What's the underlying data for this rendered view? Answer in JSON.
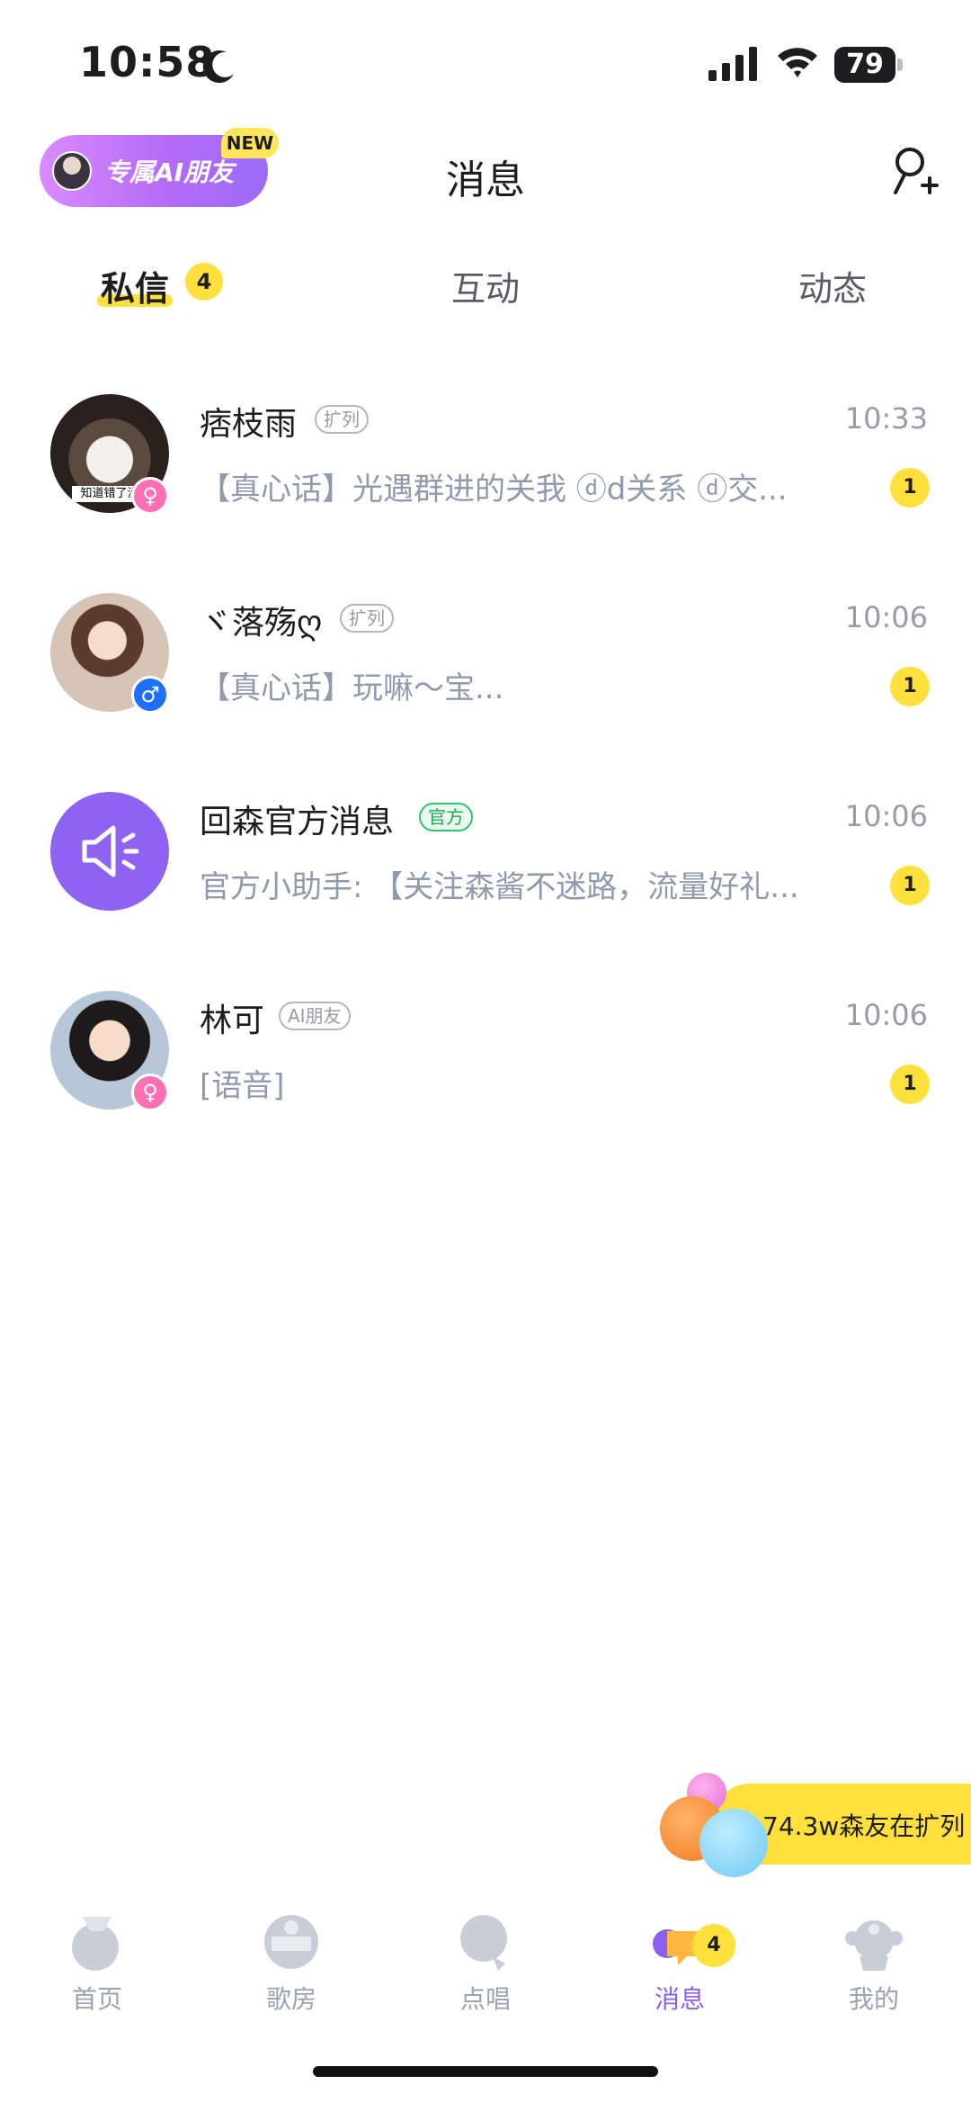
{
  "status_bar": {
    "time": "10:58",
    "battery": "79"
  },
  "header": {
    "ai_button_label": "专属AI朋友",
    "new_badge": "NEW",
    "title": "消息"
  },
  "tabs": [
    {
      "label": "私信",
      "count": "4",
      "active": true
    },
    {
      "label": "互动"
    },
    {
      "label": "动态"
    }
  ],
  "messages": [
    {
      "name": "痞枝雨",
      "tag": "扩列",
      "time": "10:33",
      "preview": "【真心话】光遇群进的关我 ⓓd关系 ⓓ交...",
      "unread": "1",
      "gender": "♀",
      "avatar_caption": "知道错了没"
    },
    {
      "name": "ヾ落殇ღ",
      "tag": "扩列",
      "time": "10:06",
      "preview": "【真心话】玩嘛～宝...",
      "unread": "1",
      "gender": "♂"
    },
    {
      "name": "回森官方消息",
      "tag": "官方",
      "time": "10:06",
      "preview": "官方小助手: 【关注森酱不迷路，流量好礼...",
      "unread": "1"
    },
    {
      "name": "林可",
      "tag": "AI朋友",
      "time": "10:06",
      "preview": "[语音]",
      "unread": "1",
      "gender": "♀"
    }
  ],
  "floating_banner": {
    "text": "74.3w森友在扩列"
  },
  "bottom_nav": [
    {
      "label": "首页",
      "icon": "home-icon"
    },
    {
      "label": "歌房",
      "icon": "room-icon"
    },
    {
      "label": "点唱",
      "icon": "sing-icon"
    },
    {
      "label": "消息",
      "icon": "message-icon",
      "badge": "4",
      "active": true
    },
    {
      "label": "我的",
      "icon": "profile-icon"
    }
  ],
  "colors": {
    "accent_yellow": "#ffe03d",
    "accent_purple": "#8c5ef0",
    "official_green": "#1faa55"
  }
}
